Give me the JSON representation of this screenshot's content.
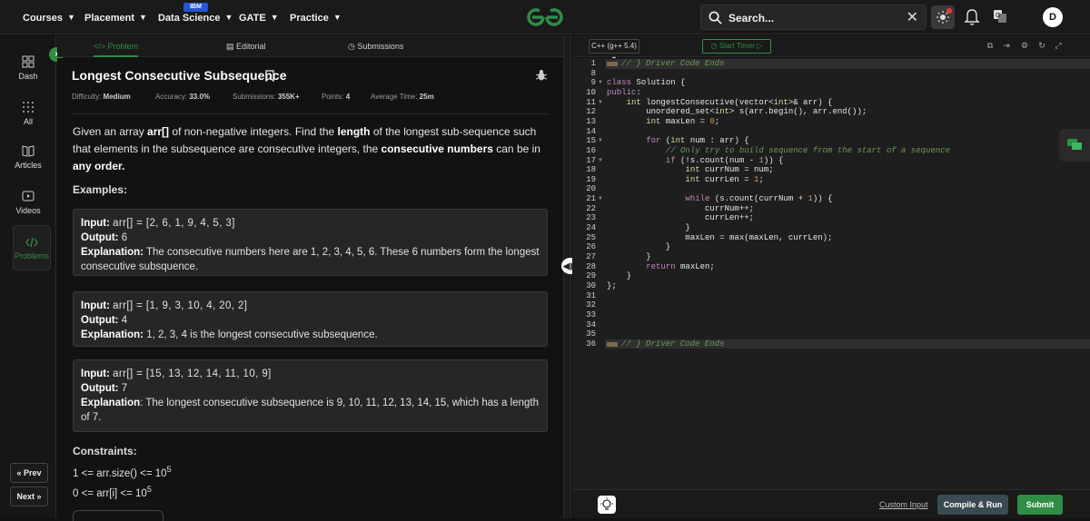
{
  "nav": {
    "items": [
      {
        "label": "Courses"
      },
      {
        "label": "Placement"
      },
      {
        "label": "Data Science",
        "badge": "IBM"
      },
      {
        "label": "GATE"
      },
      {
        "label": "Practice"
      }
    ],
    "search_label": "Search...",
    "avatar_initial": "D",
    "brand_color": "#2f8d46"
  },
  "sidebar": {
    "items": [
      {
        "label": "Dash",
        "icon": "dashboard-icon"
      },
      {
        "label": "All",
        "icon": "grid-icon"
      },
      {
        "label": "Articles",
        "icon": "book-icon"
      },
      {
        "label": "Videos",
        "icon": "video-icon"
      },
      {
        "label": "Problems",
        "icon": "code-icon",
        "active": true
      }
    ],
    "prev_label": "« Prev",
    "next_label": "Next »"
  },
  "tabs": [
    {
      "label": "</> Problem",
      "active": true
    },
    {
      "label": "Editorial"
    },
    {
      "label": "Submissions"
    }
  ],
  "problem": {
    "title": "Longest Consecutive Subsequence",
    "difficulty_label": "Difficulty:",
    "difficulty": "Medium",
    "accuracy_label": "Accuracy:",
    "accuracy": "33.0%",
    "submissions_label": "Submissions:",
    "submissions": "355K+",
    "points_label": "Points:",
    "points": "4",
    "avgtime_label": "Average Time:",
    "avgtime": "25m",
    "statement": {
      "p1": "Given an array ",
      "b1": "arr[]",
      "p2": " of non-negative integers. Find the ",
      "b2": "length",
      "p3": " of the longest sub-sequence such that elements in the subsequence are consecutive integers, the ",
      "b3": "consecutive numbers",
      "p4": " can be in ",
      "b4": "any order."
    },
    "examples_heading": "Examples:",
    "examples": [
      {
        "input_label": "Input:",
        "input": "arr[] = [2, 6, 1, 9, 4, 5, 3]",
        "output_label": "Output:",
        "output": "6",
        "explanation_label": "Explanation:",
        "explanation": "The consecutive numbers here are 1, 2, 3, 4, 5, 6. These 6 numbers form the longest consecutive subsquence."
      },
      {
        "input_label": "Input:",
        "input": "arr[] = [1, 9, 3, 10, 4, 20, 2]",
        "output_label": "Output:",
        "output": "4",
        "explanation_label": "Explanation:",
        "explanation": "1, 2, 3, 4 is the longest consecutive subsequence."
      },
      {
        "input_label": "Input:",
        "input": "arr[] = [15, 13, 12, 14, 11, 10, 9]",
        "output_label": "Output:",
        "output": "7",
        "explanation_label": "Explanation",
        "explanation": ": The longest consecutive subsequence is 9, 10, 11, 12, 13, 14, 15, which has a length of 7."
      }
    ],
    "constraints_heading": "Constraints:",
    "constraints": [
      {
        "text": "1 <= arr.size() <= 10",
        "exp": "5"
      },
      {
        "text": "0 <= arr[i] <= 10",
        "exp": "5"
      }
    ]
  },
  "editor": {
    "language": "C++ (g++ 5.4)",
    "timer_label": "Start Timer",
    "lines": [
      {
        "n": "1",
        "t": "// } Driver Code Ends",
        "kind": "hidden"
      },
      {
        "n": "8",
        "t": ""
      },
      {
        "n": "9",
        "t": "class Solution {",
        "fold": true
      },
      {
        "n": "10",
        "t": "public:"
      },
      {
        "n": "11",
        "t": "    int longestConsecutive(vector<int>& arr) {",
        "fold": true
      },
      {
        "n": "12",
        "t": "        unordered_set<int> s(arr.begin(), arr.end());"
      },
      {
        "n": "13",
        "t": "        int maxLen = 0;"
      },
      {
        "n": "14",
        "t": ""
      },
      {
        "n": "15",
        "t": "        for (int num : arr) {",
        "fold": true
      },
      {
        "n": "16",
        "t": "            // Only try to build sequence from the start of a sequence",
        "kind": "comment"
      },
      {
        "n": "17",
        "t": "            if (!s.count(num - 1)) {",
        "fold": true
      },
      {
        "n": "18",
        "t": "                int currNum = num;"
      },
      {
        "n": "19",
        "t": "                int currLen = 1;"
      },
      {
        "n": "20",
        "t": ""
      },
      {
        "n": "21",
        "t": "                while (s.count(currNum + 1)) {",
        "fold": true
      },
      {
        "n": "22",
        "t": "                    currNum++;"
      },
      {
        "n": "23",
        "t": "                    currLen++;"
      },
      {
        "n": "24",
        "t": "                }"
      },
      {
        "n": "25",
        "t": "                maxLen = max(maxLen, currLen);"
      },
      {
        "n": "26",
        "t": "            }"
      },
      {
        "n": "27",
        "t": "        }"
      },
      {
        "n": "28",
        "t": "        return maxLen;"
      },
      {
        "n": "29",
        "t": "    }"
      },
      {
        "n": "30",
        "t": "};"
      },
      {
        "n": "31",
        "t": ""
      },
      {
        "n": "32",
        "t": ""
      },
      {
        "n": "33",
        "t": ""
      },
      {
        "n": "34",
        "t": ""
      },
      {
        "n": "35",
        "t": ""
      },
      {
        "n": "36",
        "t": "// } Driver Code Ends",
        "kind": "hidden"
      }
    ]
  },
  "footer": {
    "custom_input": "Custom Input",
    "compile": "Compile & Run",
    "submit": "Submit"
  }
}
